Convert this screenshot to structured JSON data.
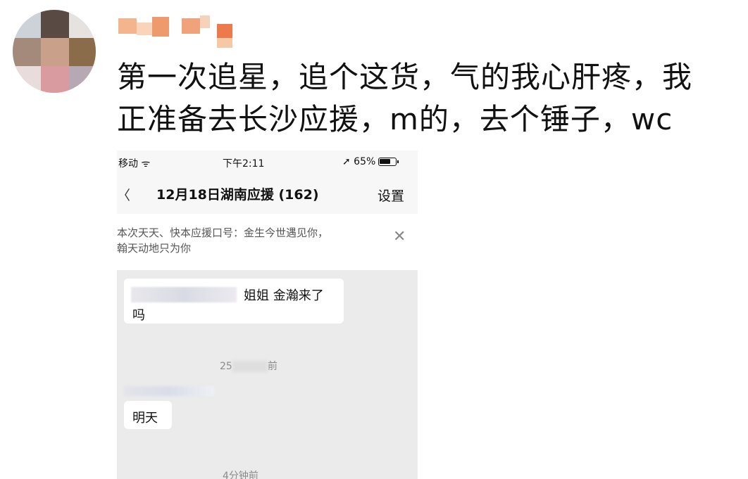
{
  "post": {
    "text_line1": "第一次追星，追个这货，气的我心肝疼，我",
    "text_line2": "正准备去长沙应援，m的，去个锤子，wc"
  },
  "screenshot": {
    "statusbar": {
      "carrier": "移动 ᯤ",
      "time": "下午2:11",
      "battery": "➚ 65%"
    },
    "navbar": {
      "back": "〈",
      "title": "12月18日湖南应援 (162)",
      "settings": "设置"
    },
    "notice": {
      "line1": "本次天天、快本应援口号：金生今世遇见你，",
      "line2": "翰天动地只为你",
      "close": "✕"
    },
    "messages": [
      {
        "text_part1": "姐姐 金瀚来了",
        "text_part2": "吗"
      },
      {
        "text": "明天"
      }
    ],
    "timestamps": {
      "first": "25",
      "first_suffix": "前",
      "second": "4分钟前"
    }
  },
  "colors": {
    "chat_bg": "#ebebeb",
    "bubble": "#ffffff",
    "text": "#111111"
  }
}
